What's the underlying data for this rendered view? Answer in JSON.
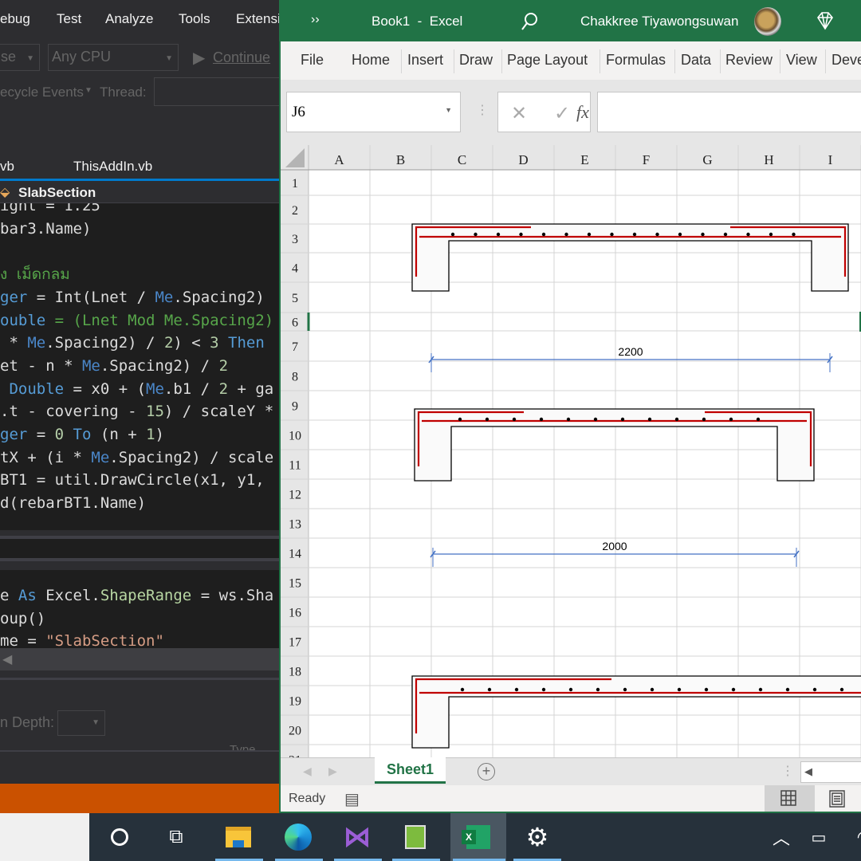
{
  "vs": {
    "menu": [
      "ebug",
      "Test",
      "Analyze",
      "Tools",
      "Extensi"
    ],
    "config_combo": "se",
    "platform_combo": "Any CPU",
    "continue_label": "Continue",
    "lifecycle_label": "ecycle Events",
    "thread_label": "Thread:",
    "tabs": [
      "vb",
      "ThisAddIn.vb"
    ],
    "member_bar": "SlabSection",
    "code_lines": [
      [
        [
          "ight = 1.25",
          "d"
        ]
      ],
      [
        [
          "bar3.Name)",
          "d"
        ]
      ],
      [],
      [
        [
          "ง เม็ดกลม",
          "c"
        ]
      ],
      [
        [
          "ger",
          "k"
        ],
        [
          " = Int(Lnet / ",
          "d"
        ],
        [
          "Me",
          "m"
        ],
        [
          ".Spacing2)",
          "d"
        ]
      ],
      [
        [
          "ouble",
          "k"
        ],
        [
          " = (Lnet Mod Me.Spacing2)",
          "c"
        ]
      ],
      [
        [
          " * ",
          "d"
        ],
        [
          "Me",
          "m"
        ],
        [
          ".Spacing2) / ",
          "d"
        ],
        [
          "2",
          "n"
        ],
        [
          ") < ",
          "d"
        ],
        [
          "3",
          "n"
        ],
        [
          " Then",
          "k"
        ]
      ],
      [
        [
          "et - n * ",
          "d"
        ],
        [
          "Me",
          "m"
        ],
        [
          ".Spacing2) / ",
          "d"
        ],
        [
          "2",
          "n"
        ]
      ],
      [
        [
          " Double",
          "k"
        ],
        [
          " = x0 + (",
          "d"
        ],
        [
          "Me",
          "m"
        ],
        [
          ".b1 / ",
          "d"
        ],
        [
          "2",
          "n"
        ],
        [
          " + ga",
          "d"
        ]
      ],
      [
        [
          ".t - covering - ",
          "d"
        ],
        [
          "15",
          "n"
        ],
        [
          ") / scaleY *",
          "d"
        ]
      ],
      [
        [
          "ger",
          "k"
        ],
        [
          " = ",
          "d"
        ],
        [
          "0",
          "n"
        ],
        [
          " To",
          "k"
        ],
        [
          " (n + ",
          "d"
        ],
        [
          "1",
          "n"
        ],
        [
          ")",
          "d"
        ]
      ],
      [
        [
          "tX + (i * ",
          "d"
        ],
        [
          "Me",
          "m"
        ],
        [
          ".Spacing2) / scale",
          "d"
        ]
      ],
      [
        [
          "BT1 = util.DrawCircle(x1, y1,",
          "d"
        ]
      ],
      [
        [
          "d(rebarBT1.Name)",
          "d"
        ]
      ]
    ],
    "code_lines2": [
      [
        [
          "e ",
          "d"
        ],
        [
          "As",
          "k"
        ],
        [
          " Excel.",
          "d"
        ],
        [
          "ShapeRange",
          "t"
        ],
        [
          " = ws.Sha",
          "d"
        ]
      ],
      [
        [
          "oup()",
          "d"
        ]
      ],
      [
        [
          "me = ",
          "d"
        ],
        [
          "\"SlabSection\"",
          "s"
        ]
      ]
    ],
    "depth_label": "n Depth:",
    "type_label": "Type"
  },
  "excel": {
    "title": "Book1  -  Excel",
    "user": "Chakkree Tiyawongsuwan",
    "ribbon_tabs": [
      "File",
      "Home",
      "Insert",
      "Draw",
      "Page Layout",
      "Formulas",
      "Data",
      "Review",
      "View",
      "Deve"
    ],
    "name_box": "J6",
    "formula": "",
    "columns": [
      "A",
      "B",
      "C",
      "D",
      "E",
      "F",
      "G",
      "H",
      "I"
    ],
    "rows": [
      "1",
      "2",
      "3",
      "4",
      "5",
      "6",
      "7",
      "8",
      "9",
      "10",
      "11",
      "12",
      "13",
      "14",
      "15",
      "16",
      "17",
      "18",
      "19",
      "20",
      "21"
    ],
    "dimensions": [
      "2200",
      "2000"
    ],
    "sheet_tab": "Sheet1",
    "status": "Ready",
    "colors": {
      "accent": "#217346",
      "rebar": "#c00000",
      "dimension": "#4472c4"
    }
  },
  "taskbar": {
    "icons": [
      "cortana-icon",
      "task-view-icon",
      "file-explorer-icon",
      "edge-icon",
      "visual-studio-icon",
      "notepad-icon",
      "excel-icon",
      "settings-icon"
    ]
  }
}
